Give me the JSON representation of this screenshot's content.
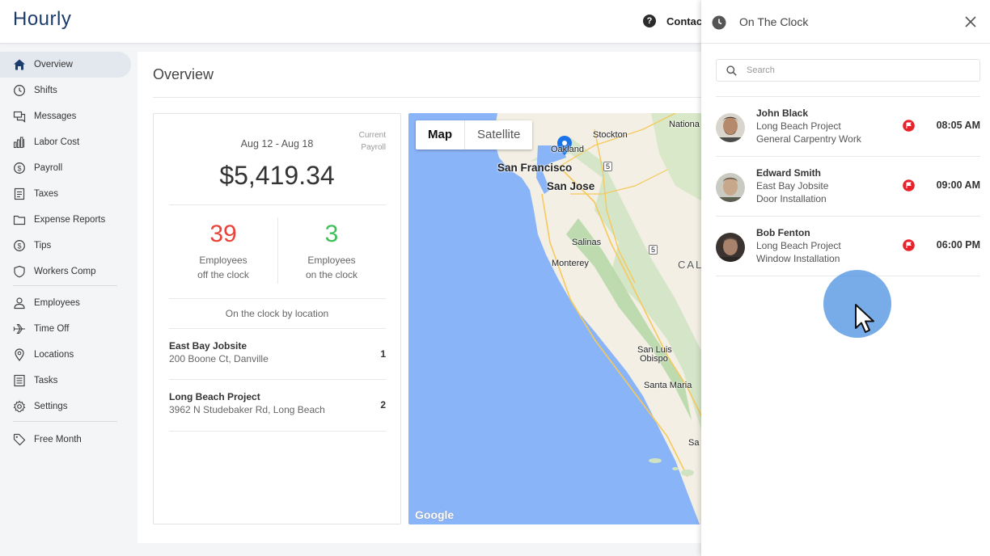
{
  "app": {
    "logo": "Hourly",
    "contact_label": "Contact"
  },
  "sidebar": {
    "items": [
      {
        "label": "Overview",
        "icon": "home-icon",
        "active": true
      },
      {
        "label": "Shifts",
        "icon": "clock-icon"
      },
      {
        "label": "Messages",
        "icon": "chat-icon"
      },
      {
        "label": "Labor Cost",
        "icon": "bar-chart-icon"
      },
      {
        "label": "Payroll",
        "icon": "dollar-icon"
      },
      {
        "label": "Taxes",
        "icon": "document-icon"
      },
      {
        "label": "Expense Reports",
        "icon": "folder-icon"
      },
      {
        "label": "Tips",
        "icon": "dollar-icon"
      },
      {
        "label": "Workers Comp",
        "icon": "shield-icon"
      },
      {
        "label": "Employees",
        "icon": "person-icon"
      },
      {
        "label": "Time Off",
        "icon": "plane-icon"
      },
      {
        "label": "Locations",
        "icon": "pin-icon"
      },
      {
        "label": "Tasks",
        "icon": "list-icon"
      },
      {
        "label": "Settings",
        "icon": "gear-icon"
      },
      {
        "label": "Free Month",
        "icon": "tag-icon"
      }
    ]
  },
  "main": {
    "title": "Overview",
    "payroll": {
      "date_range": "Aug 12 - Aug 18",
      "current_label_1": "Current",
      "current_label_2": "Payroll",
      "amount": "$5,419.34"
    },
    "stats": {
      "off_count": "39",
      "off_label_1": "Employees",
      "off_label_2": "off the clock",
      "on_count": "3",
      "on_label_1": "Employees",
      "on_label_2": "on the clock"
    },
    "locations_heading": "On the clock by location",
    "locations": [
      {
        "name": "East Bay Jobsite",
        "address": "200 Boone Ct, Danville",
        "count": "1"
      },
      {
        "name": "Long Beach Project",
        "address": "3962 N Studebaker Rd, Long Beach",
        "count": "2"
      }
    ]
  },
  "map": {
    "toggle_map": "Map",
    "toggle_satellite": "Satellite",
    "labels": {
      "oakland": "Oakland",
      "stockton": "Stockton",
      "national": "Nationa",
      "san_francisco": "San Francisco",
      "san_jose": "San Jose",
      "salinas": "Salinas",
      "monterey": "Monterey",
      "cal": "CAL",
      "san_luis_obispo_1": "San Luis",
      "san_luis_obispo_2": "Obispo",
      "santa_maria": "Santa Maria",
      "sa": "Sa",
      "shield_5a": "5",
      "shield_5b": "5"
    },
    "attribution": "Google"
  },
  "drawer": {
    "title": "On The Clock",
    "search_placeholder": "Search",
    "employees": [
      {
        "name": "John Black",
        "project": "Long Beach Project",
        "task": "General Carpentry Work",
        "time": "08:05 AM"
      },
      {
        "name": "Edward Smith",
        "project": "East Bay Jobsite",
        "task": "Door Installation",
        "time": "09:00 AM"
      },
      {
        "name": "Bob Fenton",
        "project": "Long Beach Project",
        "task": "Window Installation",
        "time": "06:00 PM"
      }
    ]
  },
  "colors": {
    "brand": "#1d3c6e",
    "off_clock": "#e8423a",
    "on_clock": "#3fbf58",
    "flag": "#e8212b",
    "map_water": "#8ab4f8",
    "cursor_halo": "#4a90e2"
  }
}
